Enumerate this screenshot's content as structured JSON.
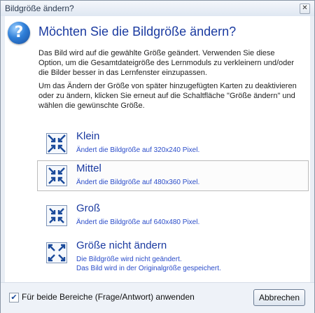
{
  "window": {
    "title": "Bildgröße ändern?",
    "close_glyph": "✕"
  },
  "heading": "Möchten Sie die Bildgröße ändern?",
  "paragraphs": [
    "Das Bild wird auf die gewählte Größe geändert. Verwenden Sie diese Option, um die Gesamtdateigröße des Lernmoduls zu verkleinern und/oder die Bilder besser in das Lernfenster einzupassen.",
    "Um das Ändern der Größe von später hinzugefügten Karten zu deaktivieren oder zu ändern, klicken Sie erneut auf die Schaltfläche \"Größe ändern\" und wählen die gewünschte Größe."
  ],
  "options": [
    {
      "title": "Klein",
      "desc": "Ändert die Bildgröße auf 320x240 Pixel.",
      "icon": "shrink-arrows-icon"
    },
    {
      "title": "Mittel",
      "desc": "Ändert die Bildgröße auf 480x360 Pixel.",
      "icon": "shrink-arrows-icon"
    },
    {
      "title": "Groß",
      "desc": "Ändert die Bildgröße auf 640x480 Pixel.",
      "icon": "shrink-arrows-icon"
    },
    {
      "title": "Größe nicht ändern",
      "desc_line1": "Die Bildgröße wird nicht geändert.",
      "desc_line2": "Das Bild wird in der Originalgröße gespeichert.",
      "icon": "expand-arrows-icon"
    }
  ],
  "footer": {
    "checkbox_label": "Für beide Bereiche (Frage/Antwort) anwenden",
    "checkbox_checked": true,
    "cancel_label": "Abbrechen"
  },
  "colors": {
    "heading": "#1a3aa0",
    "link": "#2a4cc9"
  }
}
